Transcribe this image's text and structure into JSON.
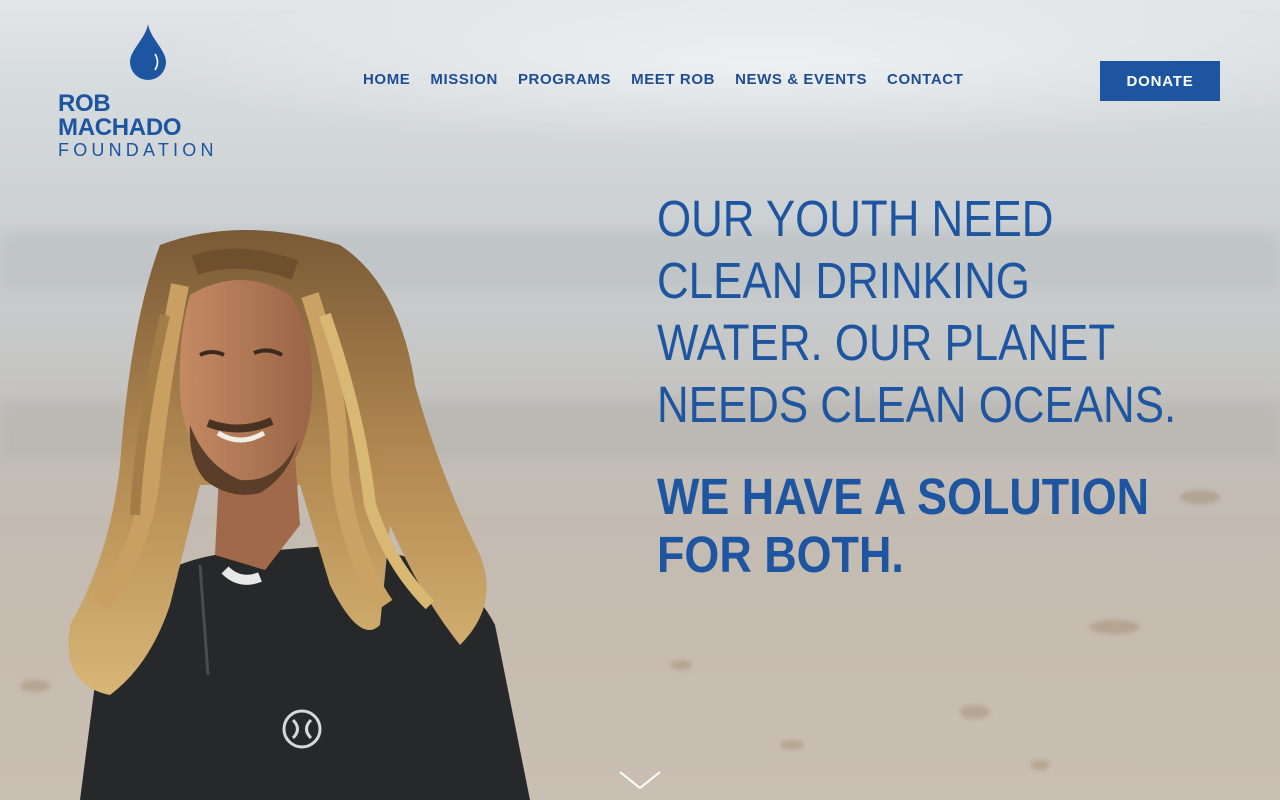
{
  "logo": {
    "line1": "ROB MACHADO",
    "line2": "FOUNDATION"
  },
  "nav": {
    "items": [
      {
        "label": "HOME"
      },
      {
        "label": "MISSION"
      },
      {
        "label": "PROGRAMS"
      },
      {
        "label": "MEET ROB"
      },
      {
        "label": "NEWS & EVENTS"
      },
      {
        "label": "CONTACT"
      }
    ]
  },
  "donate_label": "DONATE",
  "hero": {
    "headline_lines": [
      "OUR YOUTH NEED",
      "CLEAN DRINKING",
      "WATER. OUR PLANET",
      "NEEDS CLEAN OCEANS."
    ],
    "subhead_lines": [
      "WE HAVE A SOLUTION",
      "FOR BOTH."
    ]
  },
  "icons": {
    "logo": "water-drop-icon",
    "scroll": "chevron-down-icon"
  },
  "colors": {
    "brand_blue": "#1e55a0",
    "nav_blue": "#1e4d92",
    "button_text": "#ffffff"
  }
}
